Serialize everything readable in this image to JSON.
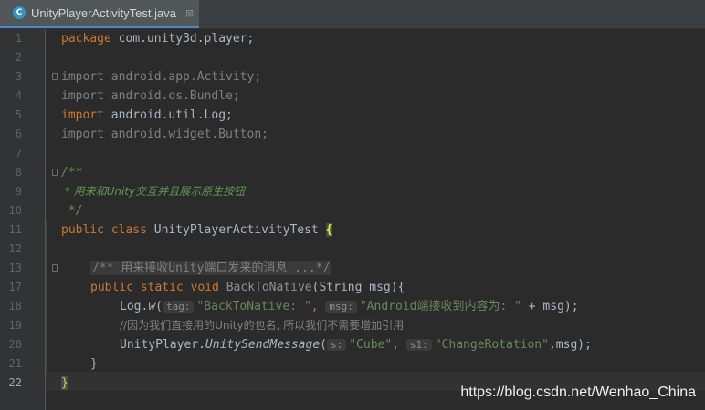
{
  "tab": {
    "icon_letter": "C",
    "title": "UnityPlayerActivityTest.java",
    "close": "⊠"
  },
  "line_numbers": [
    "1",
    "2",
    "3",
    "4",
    "5",
    "6",
    "7",
    "8",
    "9",
    "10",
    "11",
    "12",
    "13",
    "17",
    "18",
    "19",
    "20",
    "21",
    "22"
  ],
  "code": {
    "l1": {
      "kw": "package",
      "rest": " com.unity3d.player;"
    },
    "l3": {
      "text": "import android.app.Activity;"
    },
    "l4": {
      "text": "import android.os.Bundle;"
    },
    "l5": {
      "kw": "import",
      "rest": " android.util.Log;"
    },
    "l6": {
      "text": "import android.widget.Button;"
    },
    "l8": {
      "text": "/**"
    },
    "l9": {
      "text": " * 用来和Unity交互并且展示原生按钮"
    },
    "l10": {
      "text": " */"
    },
    "l11": {
      "kw": "public class",
      "name": " UnityPlayerActivityTest ",
      "brace": "{"
    },
    "l13": {
      "folded": "/** 用来接收Unity端口发来的消息 ...*/"
    },
    "l17": {
      "kw": "public static void",
      "name": " BackToNative",
      "params": "(String msg){"
    },
    "l18": {
      "call": "Log.",
      "method": "w",
      "open": "(",
      "hint1": "tag:",
      "str1": "\"BackToNative: \"",
      "comma1": ", ",
      "hint2": "msg:",
      "str2": "\"Android端接收到内容为: \"",
      "tail": " + msg);"
    },
    "l19": {
      "text": "//因为我们直接用的Unity的包名, 所以我们不需要增加引用"
    },
    "l20": {
      "call": "UnityPlayer.",
      "method": "UnitySendMessage",
      "open": "(",
      "hint1": "s:",
      "str1": "\"Cube\"",
      "comma1": ", ",
      "hint2": "s1:",
      "str2": "\"ChangeRotation\"",
      "tail": ",msg);"
    },
    "l21": {
      "text": "}"
    },
    "l22": {
      "text": "}"
    }
  },
  "watermark": "https://blog.csdn.net/Wenhao_China",
  "colors": {
    "background": "#2b2b2b",
    "keyword": "#cc7832",
    "string": "#6a8759",
    "doc_comment": "#629755",
    "comment": "#808080",
    "plain": "#a9b7c6"
  }
}
